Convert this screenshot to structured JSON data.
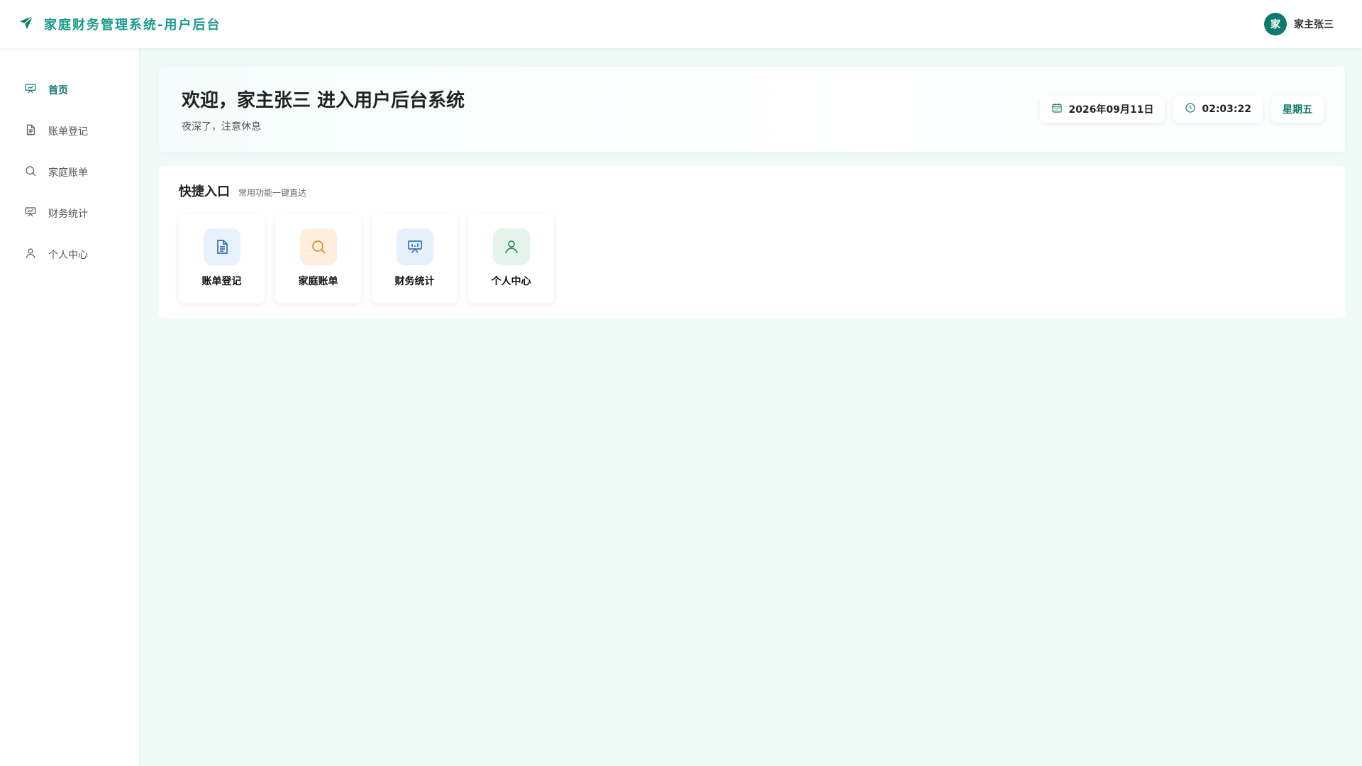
{
  "app": {
    "title": "家庭财务管理系统-用户后台",
    "brand_color": "#1a9c8a"
  },
  "user": {
    "avatar_text": "家",
    "name": "家主张三"
  },
  "sidebar": {
    "items": [
      {
        "label": "首页",
        "icon": "presentation-chart-icon",
        "active": true
      },
      {
        "label": "账单登记",
        "icon": "document-icon"
      },
      {
        "label": "家庭账单",
        "icon": "search-icon"
      },
      {
        "label": "财务统计",
        "icon": "presentation-chart-icon"
      },
      {
        "label": "个人中心",
        "icon": "user-icon"
      }
    ]
  },
  "welcome": {
    "title": "欢迎，家主张三 进入用户后台系统",
    "subtitle": "夜深了，注意休息",
    "date": "2026年09月11日",
    "time": "02:03:22",
    "weekday": "星期五"
  },
  "quick": {
    "title": "快捷入口",
    "subtitle": "常用功能一键直达",
    "cards": [
      {
        "label": "账单登记",
        "icon": "document-icon",
        "bg": "#e8f2fd",
        "fg": "#2f6fb3"
      },
      {
        "label": "家庭账单",
        "icon": "search-icon",
        "bg": "#fdeedd",
        "fg": "#e58a2b"
      },
      {
        "label": "财务统计",
        "icon": "presentation-chart-icon",
        "bg": "#e7f1fb",
        "fg": "#3577b8"
      },
      {
        "label": "个人中心",
        "icon": "user-icon",
        "bg": "#e5f5ec",
        "fg": "#2e8a55"
      }
    ]
  }
}
